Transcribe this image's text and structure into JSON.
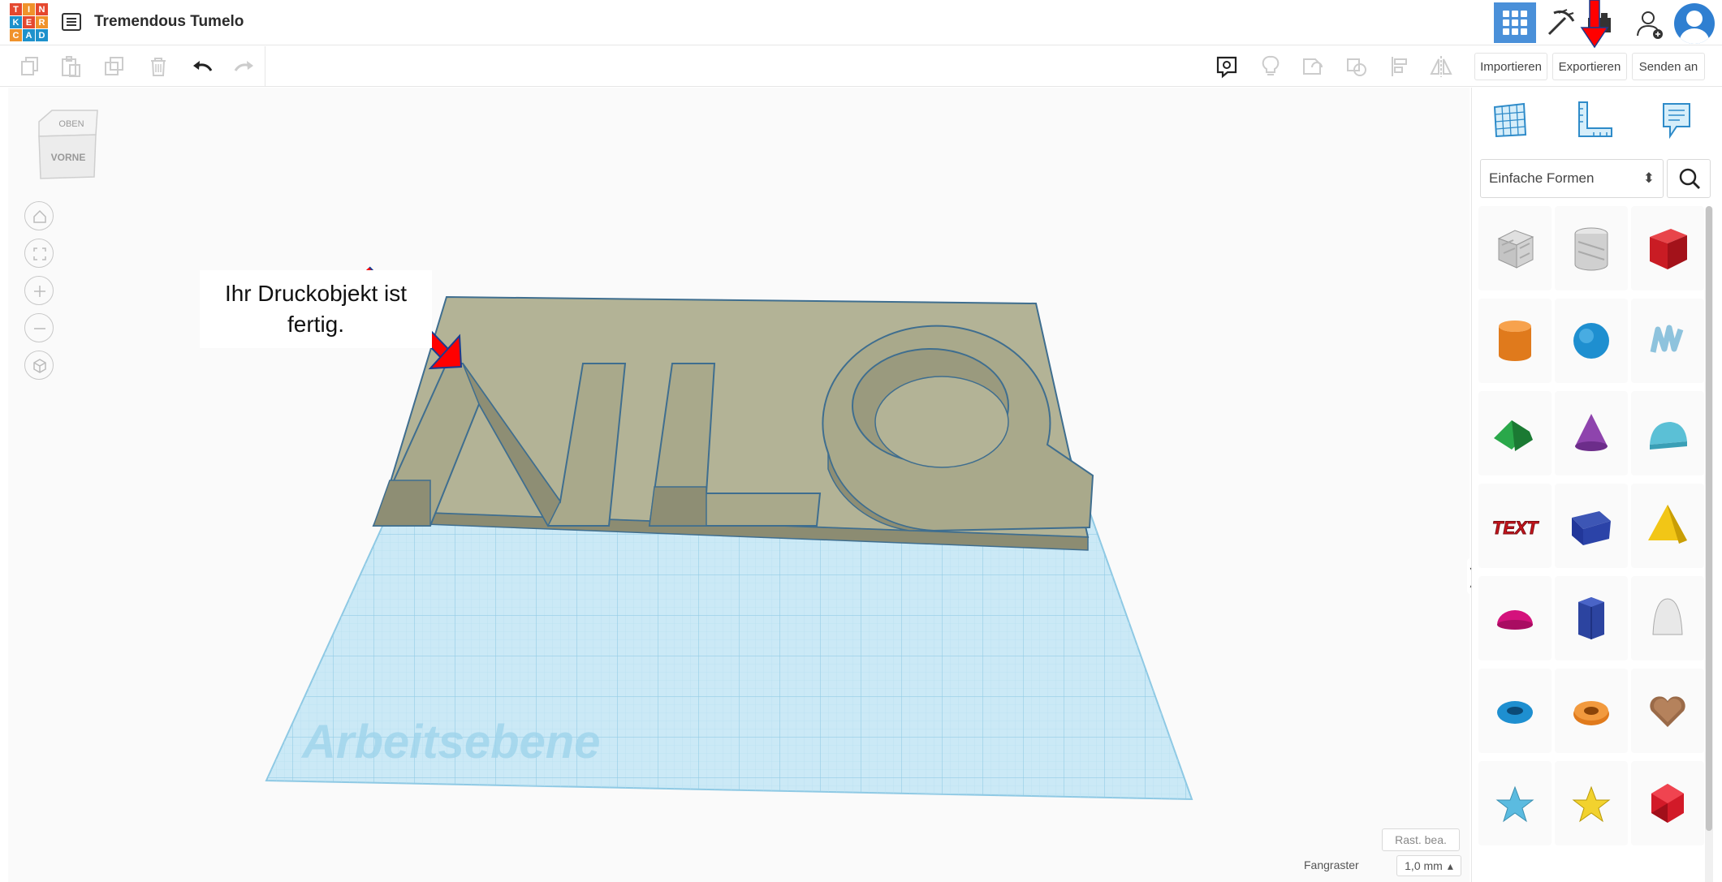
{
  "app": {
    "logo_letters": [
      "T",
      "I",
      "N",
      "K",
      "E",
      "R",
      "C",
      "A",
      "D"
    ],
    "title": "Tremendous Tumelo"
  },
  "toolbar": {
    "import_label": "Importieren",
    "export_label": "Exportieren",
    "send_label": "Senden an"
  },
  "workplane": {
    "viewcube_top": "OBEN",
    "viewcube_front": "VORNE",
    "plane_label": "Arbeitsebene",
    "model_text": "NLQ",
    "callout": "Ihr Druckobjekt ist fertig.",
    "edit_grid_label": "Rast. bea.",
    "snap_label": "Fangraster",
    "snap_value": "1,0 mm",
    "snap_caret": "▴",
    "collapse_glyph": "❭"
  },
  "panel": {
    "category": "Einfache Formen",
    "category_caret": "⬍",
    "shapes": [
      "box-hole",
      "cylinder-hole",
      "box",
      "cylinder",
      "sphere",
      "scribble",
      "roof",
      "cone",
      "round-roof",
      "text",
      "half-cylinder-prism",
      "pyramid",
      "half-sphere",
      "hexagonal-prism",
      "paraboloid",
      "torus",
      "tube",
      "heart",
      "star",
      "star-yellow",
      "icosahedron"
    ]
  },
  "colors": {
    "accent_blue": "#4a90d9",
    "annotation_red": "#ff0000",
    "grid_blue": "#a9d8ee",
    "model_olive": "#a9a98b"
  }
}
